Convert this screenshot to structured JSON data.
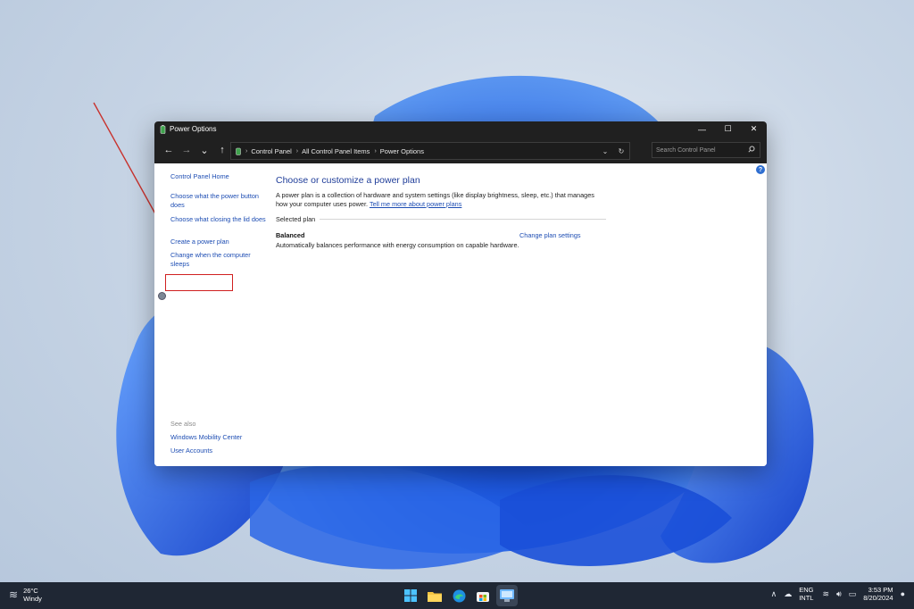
{
  "window": {
    "title": "Power Options",
    "controls": {
      "minimize": "—",
      "maximize": "☐",
      "close": "✕"
    }
  },
  "addressbar": {
    "back": "←",
    "forward": "→",
    "recent": "⌄",
    "up": "↑",
    "breadcrumbs": [
      "Control Panel",
      "All Control Panel Items",
      "Power Options"
    ],
    "separator": "›",
    "dropdown": "⌄",
    "refresh": "↻",
    "search_placeholder": "Search Control Panel"
  },
  "sidebar": {
    "home": "Control Panel Home",
    "items": [
      "Choose what the power button does",
      "Choose what closing the lid does",
      "Create a power plan",
      "Change when the computer sleeps"
    ],
    "see_also_label": "See also",
    "see_also": [
      "Windows Mobility Center",
      "User Accounts"
    ]
  },
  "main": {
    "heading": "Choose or customize a power plan",
    "description": "A power plan is a collection of hardware and system settings (like display brightness, sleep, etc.) that manages how your computer uses power.",
    "learn_more": "Tell me more about power plans",
    "selected_plan_label": "Selected plan",
    "plan": {
      "name": "Balanced",
      "description": "Automatically balances performance with energy consumption on capable hardware.",
      "change_link": "Change plan settings"
    },
    "help": "?"
  },
  "taskbar": {
    "weather": {
      "temp": "26°C",
      "condition": "Windy"
    },
    "language": {
      "line1": "ENG",
      "line2": "INTL"
    },
    "clock": {
      "time": "3:53 PM",
      "date": "8/20/2024"
    },
    "chevron": "∧"
  },
  "colors": {
    "accent_link": "#1d4db3",
    "heading": "#1f3d99",
    "highlight_box": "#d02020",
    "titlebar": "#202020",
    "taskbar": "#1f2734"
  }
}
